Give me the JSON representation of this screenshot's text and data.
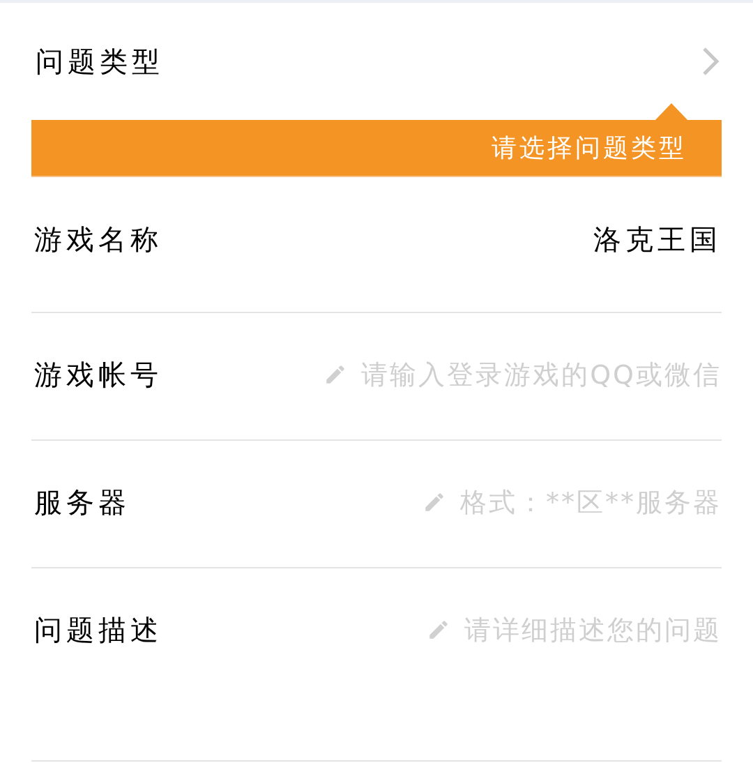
{
  "issue_type": {
    "label": "问题类型",
    "tooltip": "请选择问题类型"
  },
  "fields": [
    {
      "label": "游戏名称",
      "kind": "value",
      "value": "洛克王国"
    },
    {
      "label": "游戏帐号",
      "kind": "input",
      "placeholder": "请输入登录游戏的QQ或微信"
    },
    {
      "label": "服务器",
      "kind": "input",
      "placeholder": "格式：**区**服务器"
    },
    {
      "label": "问题描述",
      "kind": "textarea",
      "placeholder": "请详细描述您的问题"
    }
  ]
}
